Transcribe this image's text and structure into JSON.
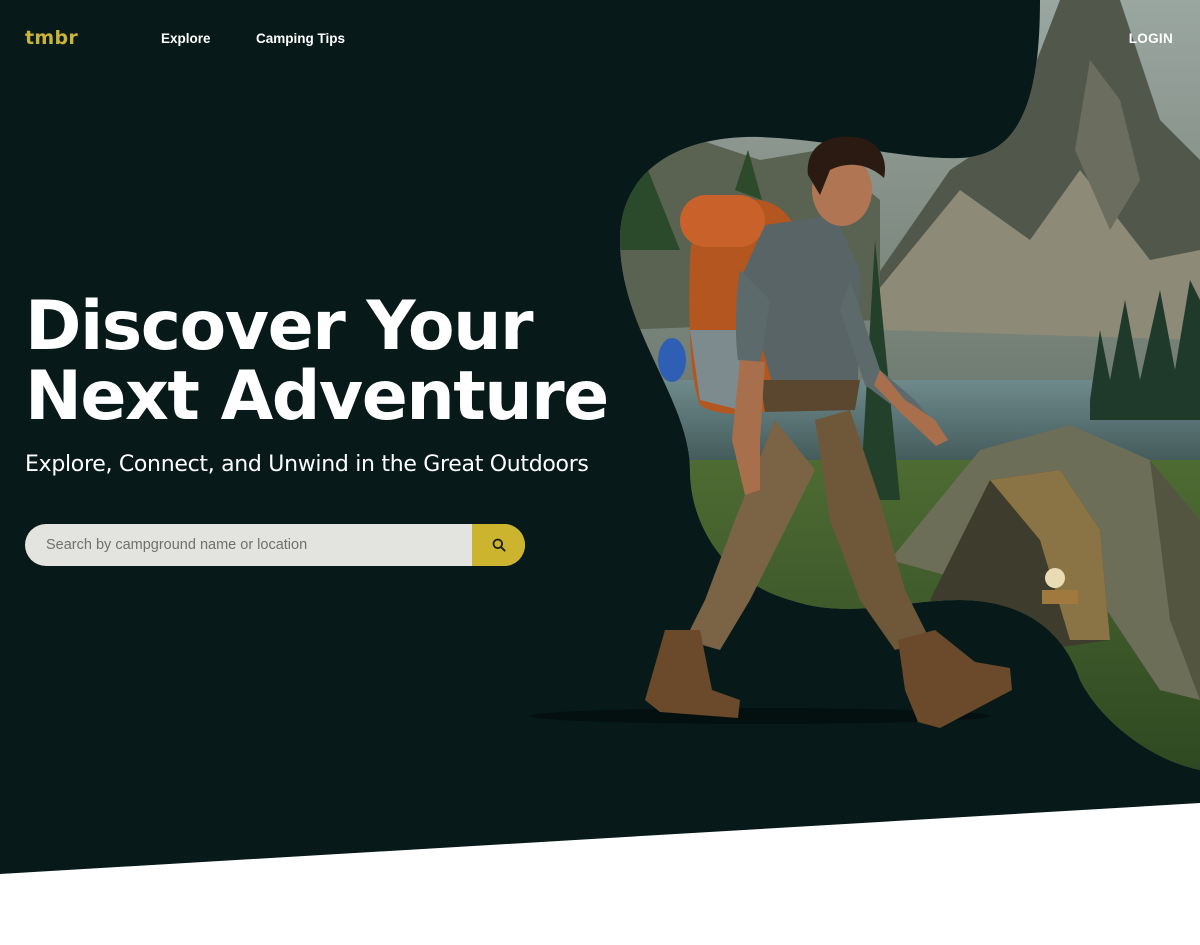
{
  "nav": {
    "logo": "tmbr",
    "links": [
      {
        "label": "Explore"
      },
      {
        "label": "Camping Tips"
      }
    ],
    "login_label": "LOGIN"
  },
  "hero": {
    "headline_line1": "Discover Your",
    "headline_line2": "Next Adventure",
    "subheading": "Explore, Connect, and Unwind in the Great Outdoors",
    "image_alt": "Hiker with backpack walking past a tent and lake beneath mountains"
  },
  "search": {
    "placeholder": "Search by campground name or location",
    "value": "",
    "button_icon": "search-icon"
  },
  "colors": {
    "background": "#08191a",
    "accent": "#cdb42f",
    "logo": "#c9b338",
    "search_field": "#e3e3df",
    "text": "#ffffff"
  }
}
